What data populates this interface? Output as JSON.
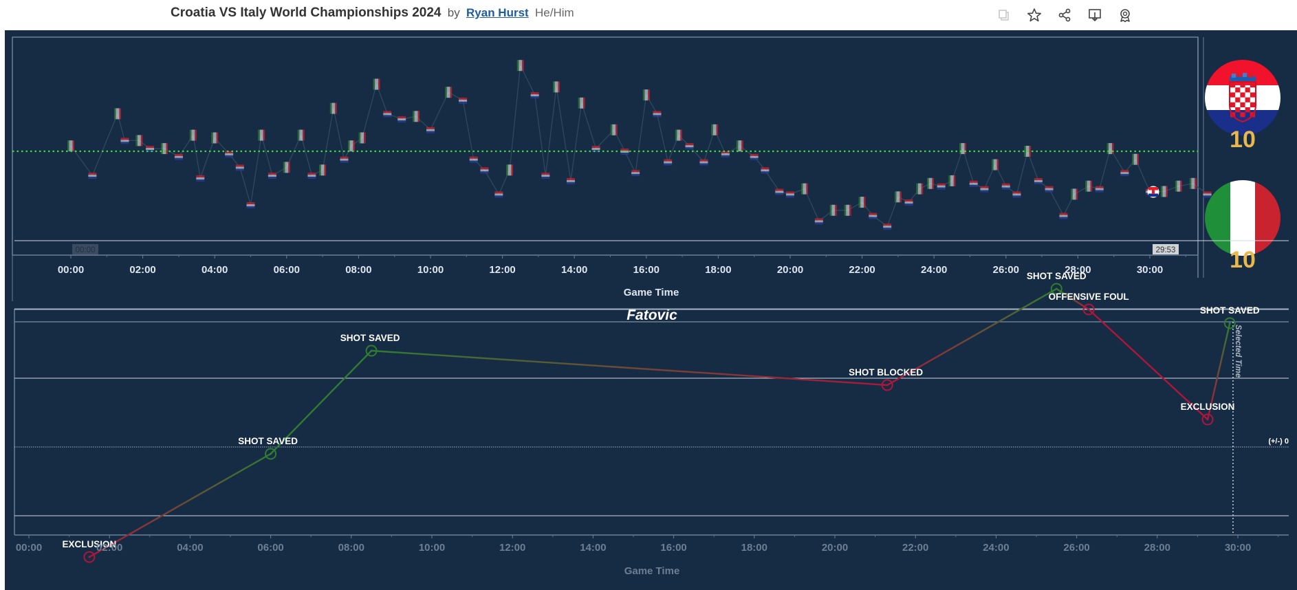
{
  "header": {
    "title": "Croatia VS Italy World Championships 2024",
    "by": "by",
    "author": "Ryan Hurst",
    "pronouns": "He/Him",
    "icons": [
      "copy-icon",
      "star-icon",
      "share-icon",
      "download-icon",
      "badge-icon"
    ]
  },
  "scores": {
    "croatia": "10",
    "italy": "10"
  },
  "colors": {
    "background": "#162b44",
    "positive": "#2e7d32",
    "negative": "#b0163a",
    "score": "#e9b84c",
    "reference_line": "#3ddc3d"
  },
  "top_chart": {
    "xlabel": "Game Time",
    "ticks": [
      "00:00",
      "02:00",
      "04:00",
      "06:00",
      "08:00",
      "10:00",
      "12:00",
      "14:00",
      "16:00",
      "18:00",
      "20:00",
      "22:00",
      "24:00",
      "26:00",
      "28:00",
      "30:00"
    ],
    "start_label": "00:00",
    "end_label": "29:53"
  },
  "bottom_chart": {
    "title": "Fatovic",
    "xlabel": "Game Time",
    "ticks": [
      "00:00",
      "02:00",
      "04:00",
      "06:00",
      "08:00",
      "10:00",
      "12:00",
      "14:00",
      "16:00",
      "18:00",
      "20:00",
      "22:00",
      "24:00",
      "26:00",
      "28:00",
      "30:00"
    ],
    "selected_time_label": "Selected Time",
    "plusminus_label": "(+/-) 0"
  },
  "chart_data": [
    {
      "type": "line",
      "title": "",
      "xlabel": "Game Time",
      "ylabel": "",
      "xlim": [
        -1.6,
        31.6
      ],
      "reference_line": 0,
      "series": [
        {
          "x": [
            0.0,
            0.6,
            1.3,
            1.5,
            1.9,
            2.2,
            2.6,
            3.0,
            3.4,
            3.6,
            4.0,
            4.4,
            4.7,
            5.0,
            5.3,
            5.6,
            6.0,
            6.4,
            6.7,
            7.0,
            7.3,
            7.6,
            7.8,
            8.1,
            8.5,
            8.8,
            9.2,
            9.6,
            10.0,
            10.5,
            10.9,
            11.2,
            11.5,
            11.9,
            12.2,
            12.5,
            12.9,
            13.2,
            13.5,
            13.9,
            14.2,
            14.6,
            15.1,
            15.4,
            15.7,
            16.0,
            16.3,
            16.6,
            16.9,
            17.2,
            17.6,
            17.9,
            18.2,
            18.6,
            19.0,
            19.3,
            19.7,
            20.0,
            20.4,
            20.8,
            21.2,
            21.6,
            22.0,
            22.3,
            22.7,
            23.0,
            23.3,
            23.6,
            23.9,
            24.2,
            24.5,
            24.8,
            25.1,
            25.4,
            25.7,
            26.0,
            26.3,
            26.6,
            26.9,
            27.2,
            27.6,
            27.9,
            28.3,
            28.6,
            28.9,
            29.3,
            29.6,
            30.0,
            30.4,
            30.8,
            31.2,
            31.6
          ],
          "y": [
            0.2,
            -0.9,
            1.4,
            0.4,
            0.4,
            0.1,
            0.1,
            -0.2,
            0.6,
            -1.0,
            0.5,
            -0.1,
            -0.6,
            -2.0,
            0.6,
            -0.9,
            -0.6,
            0.6,
            -0.9,
            -0.7,
            1.6,
            -0.3,
            0.2,
            0.5,
            2.5,
            1.4,
            1.2,
            1.3,
            0.8,
            2.2,
            1.9,
            -0.3,
            -0.7,
            -1.6,
            -0.7,
            3.2,
            2.1,
            -0.9,
            2.4,
            -1.1,
            1.8,
            0.1,
            0.8,
            0.0,
            -0.8,
            2.1,
            1.4,
            -0.4,
            0.6,
            0.2,
            -0.4,
            0.8,
            -0.1,
            0.2,
            -0.2,
            -0.7,
            -1.5,
            -1.6,
            -1.4,
            -2.6,
            -2.2,
            -2.2,
            -1.9,
            -2.4,
            -2.8,
            -1.7,
            -1.9,
            -1.4,
            -1.2,
            -1.3,
            -1.1,
            0.1,
            -1.2,
            -1.4,
            -0.5,
            -1.3,
            -1.6,
            0.0,
            -1.1,
            -1.4,
            -2.4,
            -1.6,
            -1.3,
            -1.4,
            0.1,
            -0.8,
            -0.3,
            -1.5,
            -1.5,
            -1.3,
            -1.2,
            -1.6
          ]
        }
      ],
      "x_tick_labels": [
        "00:00",
        "02:00",
        "04:00",
        "06:00",
        "08:00",
        "10:00",
        "12:00",
        "14:00",
        "16:00",
        "18:00",
        "20:00",
        "22:00",
        "24:00",
        "26:00",
        "28:00",
        "30:00"
      ],
      "current_time": "29:53"
    },
    {
      "type": "line",
      "title": "Fatovic",
      "xlabel": "Game Time",
      "ylabel": "",
      "xlim": [
        0,
        31.6
      ],
      "ylim": [
        -2,
        3
      ],
      "series": [
        {
          "x": [
            1.5,
            6.0,
            8.5,
            21.3,
            25.5,
            26.3,
            29.25,
            29.8
          ],
          "y": [
            -1.6,
            -0.1,
            1.4,
            0.9,
            2.3,
            2.0,
            0.4,
            1.8
          ],
          "events": [
            "EXCLUSION",
            "SHOT SAVED",
            "SHOT SAVED",
            "SHOT BLOCKED",
            "SHOT SAVED",
            "OFFENSIVE FOUL",
            "EXCLUSION",
            "SHOT SAVED"
          ]
        }
      ],
      "x_tick_labels": [
        "00:00",
        "02:00",
        "04:00",
        "06:00",
        "08:00",
        "10:00",
        "12:00",
        "14:00",
        "16:00",
        "18:00",
        "20:00",
        "22:00",
        "24:00",
        "26:00",
        "28:00",
        "30:00"
      ],
      "selected_time": 29.88,
      "annotations": [
        "Selected Time",
        "(+/-) 0"
      ]
    }
  ]
}
